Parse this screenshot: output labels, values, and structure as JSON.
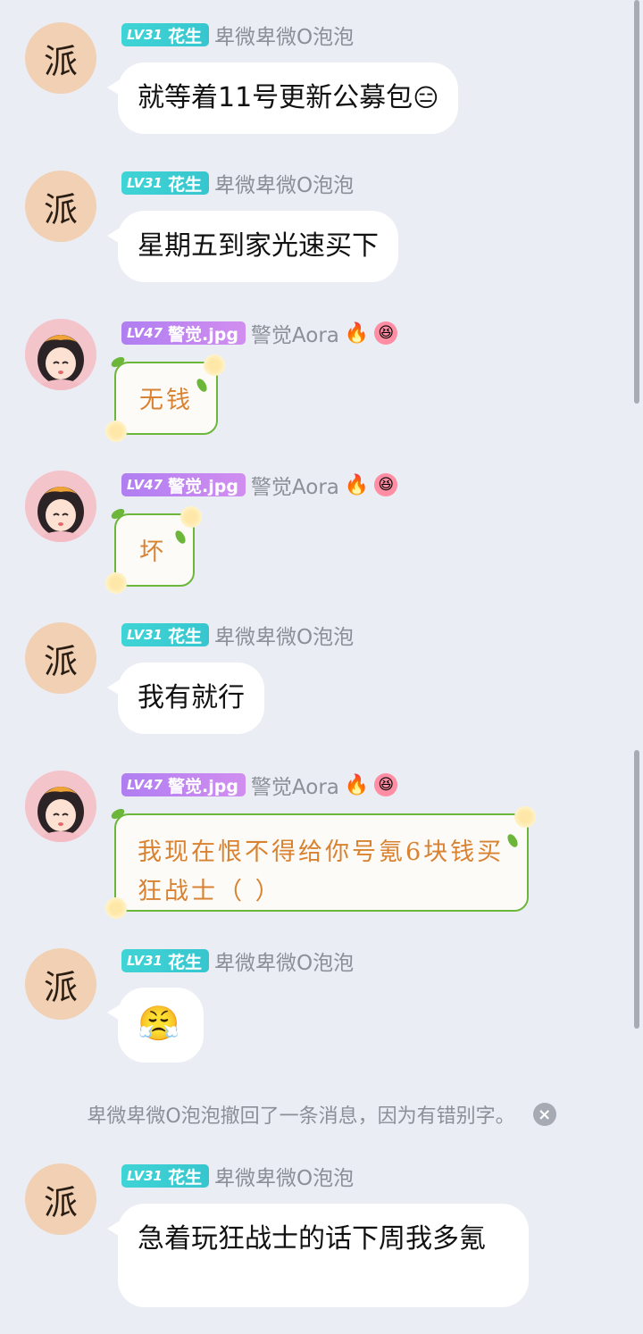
{
  "users": {
    "peanut": {
      "level": "LV31",
      "title": "花生",
      "nickname": "卑微卑微O泡泡",
      "avatar_glyph": "派",
      "level_color": "#3fd4d6"
    },
    "alert": {
      "level": "LV47",
      "title": "警觉.jpg",
      "nickname": "警觉Aora",
      "badge_icons": [
        "fire-icon",
        "smile-face-icon"
      ],
      "level_color": "#b07ef1"
    }
  },
  "messages": [
    {
      "user": "peanut",
      "text": "就等着11号更新公募包",
      "emoji": "😑"
    },
    {
      "user": "peanut",
      "text": "星期五到家光速买下"
    },
    {
      "user": "alert",
      "text": "无钱",
      "style": "fancy"
    },
    {
      "user": "alert",
      "text": "坏",
      "style": "fancy"
    },
    {
      "user": "peanut",
      "text": "我有就行"
    },
    {
      "user": "alert",
      "text": "我现在恨不得给你号氪6块钱买狂战士（ ）",
      "style": "fancy"
    },
    {
      "user": "peanut",
      "text": "",
      "emoji": "😤"
    },
    {
      "user": "peanut",
      "text": "急着玩狂战士的话下周我多氪"
    }
  ],
  "recall_notice": "卑微卑微O泡泡撤回了一条消息，因为有错别字。",
  "close_icon": "×"
}
